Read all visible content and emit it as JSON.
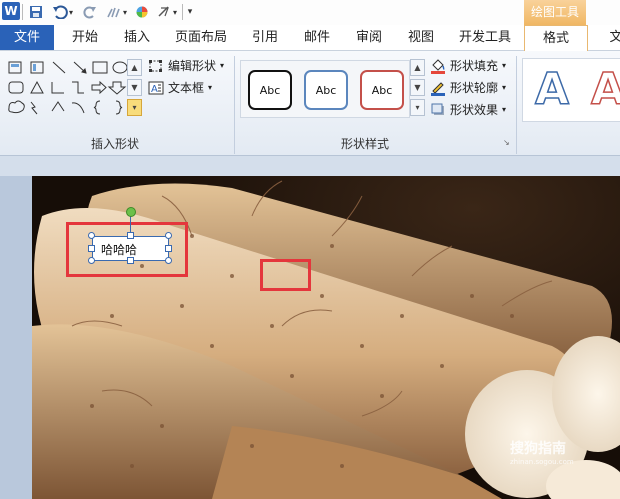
{
  "quick_access": {
    "app_icon": "word-app-icon",
    "items": [
      "save-icon",
      "undo-icon",
      "redo-icon",
      "format-painter-icon",
      "color-icon",
      "clear-format-icon",
      "customize-icon"
    ]
  },
  "tabs": {
    "file": "文件",
    "items": [
      "开始",
      "插入",
      "页面布局",
      "引用",
      "邮件",
      "审阅",
      "视图",
      "开发工具"
    ],
    "context_group": "绘图工具",
    "active": "格式",
    "overflow": "文"
  },
  "ribbon": {
    "insert_shapes": {
      "label": "插入形状",
      "edit_shape": "编辑形状",
      "text_box": "文本框"
    },
    "shape_styles": {
      "label": "形状样式",
      "styles": [
        "Abc",
        "Abc",
        "Abc"
      ],
      "fill": "形状填充",
      "outline": "形状轮廓",
      "effects": "形状效果"
    },
    "wordart": {
      "letters": [
        "A",
        "A"
      ]
    }
  },
  "document": {
    "textbox_text": "哈哈哈",
    "watermark_main": "搜狗指南",
    "watermark_sub": "zhinan.sogou.com"
  },
  "colors": {
    "accent_blue": "#2a62b8",
    "context_orange": "#f0b764",
    "highlight_red": "#e4363c"
  }
}
